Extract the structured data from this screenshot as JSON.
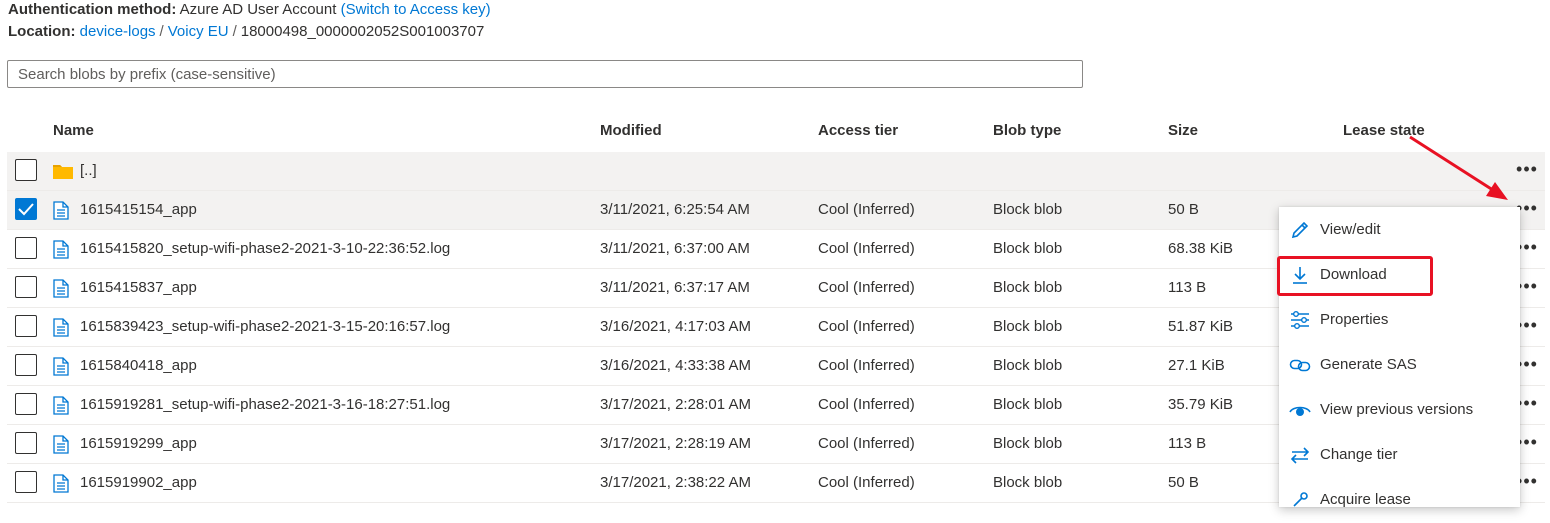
{
  "auth": {
    "label": "Authentication method:",
    "value": "Azure AD User Account",
    "switch_link": "(Switch to Access key)"
  },
  "location": {
    "label": "Location:",
    "crumbs": [
      "device-logs",
      "Voicy EU",
      "18000498_0000002052S001003707"
    ],
    "separator": "/"
  },
  "search": {
    "placeholder": "Search blobs by prefix (case-sensitive)",
    "value": ""
  },
  "columns": [
    "Name",
    "Modified",
    "Access tier",
    "Blob type",
    "Size",
    "Lease state"
  ],
  "parent_row": {
    "name": "[..]"
  },
  "rows": [
    {
      "name": "1615415154_app",
      "modified": "3/11/2021, 6:25:54 AM",
      "tier": "Cool (Inferred)",
      "type": "Block blob",
      "size": "50 B",
      "checked": true
    },
    {
      "name": "1615415820_setup-wifi-phase2-2021-3-10-22:36:52.log",
      "modified": "3/11/2021, 6:37:00 AM",
      "tier": "Cool (Inferred)",
      "type": "Block blob",
      "size": "68.38 KiB",
      "checked": false
    },
    {
      "name": "1615415837_app",
      "modified": "3/11/2021, 6:37:17 AM",
      "tier": "Cool (Inferred)",
      "type": "Block blob",
      "size": "113 B",
      "checked": false
    },
    {
      "name": "1615839423_setup-wifi-phase2-2021-3-15-20:16:57.log",
      "modified": "3/16/2021, 4:17:03 AM",
      "tier": "Cool (Inferred)",
      "type": "Block blob",
      "size": "51.87 KiB",
      "checked": false
    },
    {
      "name": "1615840418_app",
      "modified": "3/16/2021, 4:33:38 AM",
      "tier": "Cool (Inferred)",
      "type": "Block blob",
      "size": "27.1 KiB",
      "checked": false
    },
    {
      "name": "1615919281_setup-wifi-phase2-2021-3-16-18:27:51.log",
      "modified": "3/17/2021, 2:28:01 AM",
      "tier": "Cool (Inferred)",
      "type": "Block blob",
      "size": "35.79 KiB",
      "checked": false
    },
    {
      "name": "1615919299_app",
      "modified": "3/17/2021, 2:28:19 AM",
      "tier": "Cool (Inferred)",
      "type": "Block blob",
      "size": "113 B",
      "checked": false
    },
    {
      "name": "1615919902_app",
      "modified": "3/17/2021, 2:38:22 AM",
      "tier": "Cool (Inferred)",
      "type": "Block blob",
      "size": "50 B",
      "checked": false
    }
  ],
  "more_glyph": "•••",
  "context_menu": {
    "items": [
      {
        "label": "View/edit",
        "icon": "pencil-icon"
      },
      {
        "label": "Download",
        "icon": "download-icon"
      },
      {
        "label": "Properties",
        "icon": "properties-icon"
      },
      {
        "label": "Generate SAS",
        "icon": "link-icon"
      },
      {
        "label": "View previous versions",
        "icon": "eye-icon"
      },
      {
        "label": "Change tier",
        "icon": "swap-arrows-icon"
      },
      {
        "label": "Acquire lease",
        "icon": "lease-icon"
      }
    ]
  },
  "colors": {
    "accent": "#0078d4",
    "highlight": "#e81123",
    "folder": "#ffb900"
  }
}
